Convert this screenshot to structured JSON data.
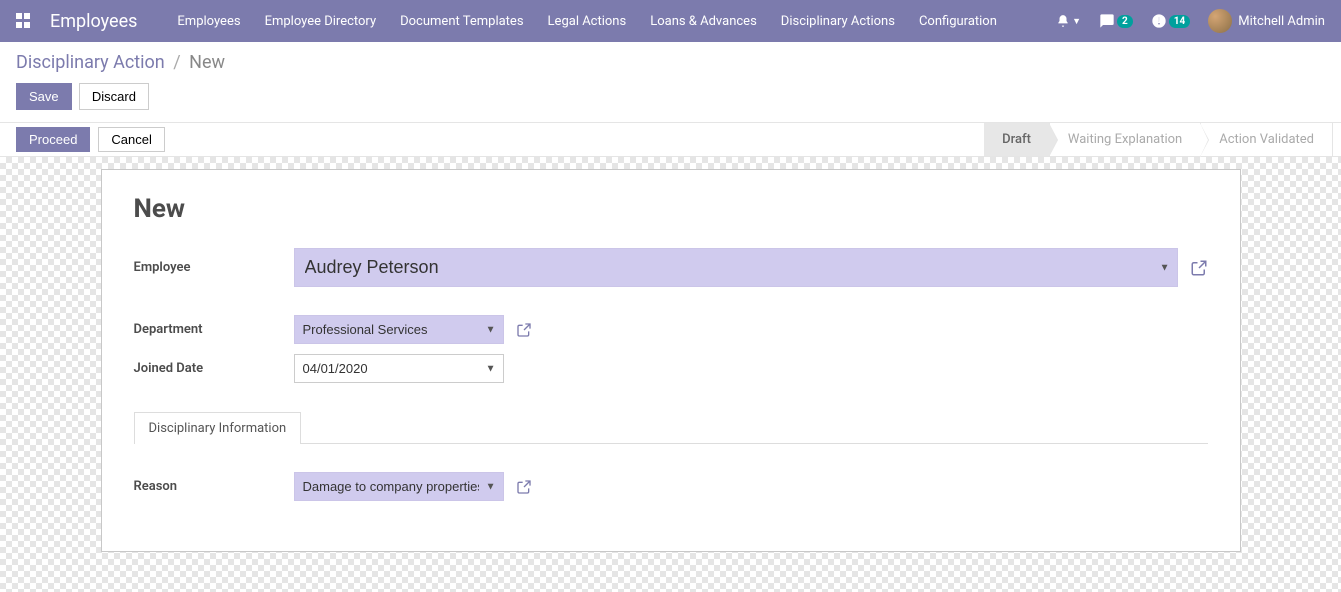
{
  "nav": {
    "brand": "Employees",
    "menu": [
      "Employees",
      "Employee Directory",
      "Document Templates",
      "Legal Actions",
      "Loans & Advances",
      "Disciplinary Actions",
      "Configuration"
    ],
    "messages_badge": "2",
    "activities_badge": "14",
    "user": "Mitchell Admin"
  },
  "breadcrumb": {
    "parent": "Disciplinary Action",
    "current": "New"
  },
  "actions": {
    "save": "Save",
    "discard": "Discard"
  },
  "statusbar": {
    "proceed": "Proceed",
    "cancel": "Cancel",
    "stages": [
      "Draft",
      "Waiting Explanation",
      "Action Validated"
    ],
    "active_index": 0
  },
  "form": {
    "title": "New",
    "labels": {
      "employee": "Employee",
      "department": "Department",
      "joined_date": "Joined Date",
      "reason": "Reason"
    },
    "values": {
      "employee": "Audrey Peterson",
      "department": "Professional Services",
      "joined_date": "04/01/2020",
      "reason": "Damage to company properties"
    },
    "tab": "Disciplinary Information"
  }
}
